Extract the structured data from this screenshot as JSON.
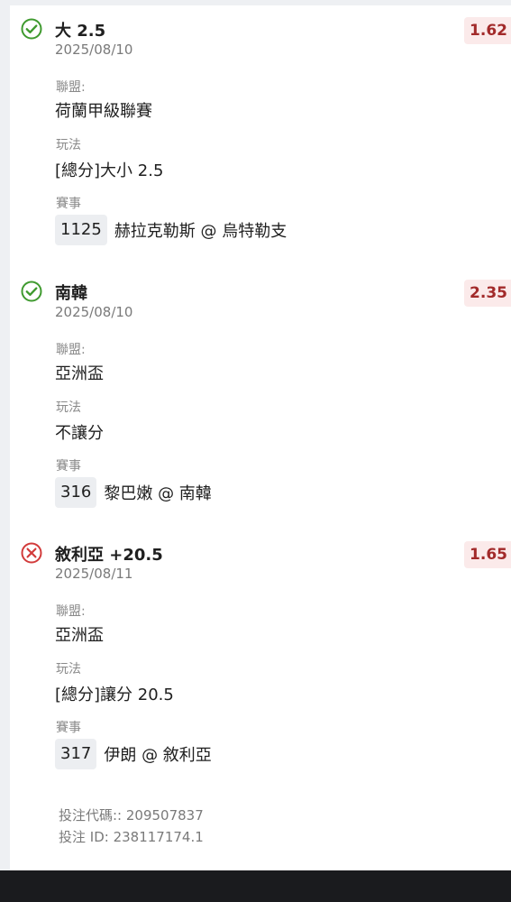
{
  "bets": [
    {
      "status": "win",
      "selection": "大 2.5",
      "odds": "1.62",
      "date": "2025/08/10",
      "league_label": "聯盟:",
      "league": "荷蘭甲級聯賽",
      "market_label": "玩法",
      "market": "[總分]大小 2.5",
      "event_label": "賽事",
      "event_code": "1125",
      "event_name": "赫拉克勒斯 @ 烏特勒支"
    },
    {
      "status": "win",
      "selection": "南韓",
      "odds": "2.35",
      "date": "2025/08/10",
      "league_label": "聯盟:",
      "league": "亞洲盃",
      "market_label": "玩法",
      "market": "不讓分",
      "event_label": "賽事",
      "event_code": "316",
      "event_name": "黎巴嫩 @ 南韓"
    },
    {
      "status": "lose",
      "selection": "敘利亞 +20.5",
      "odds": "1.65",
      "date": "2025/08/11",
      "league_label": "聯盟:",
      "league": "亞洲盃",
      "market_label": "玩法",
      "market": "[總分]讓分 20.5",
      "event_label": "賽事",
      "event_code": "317",
      "event_name": "伊朗 @ 敘利亞"
    }
  ],
  "footer": {
    "bet_code": "投注代碼:: 209507837",
    "bet_id": "投注 ID: 238117174.1"
  },
  "icons": {
    "win": "check-circle-icon",
    "lose": "x-circle-icon"
  },
  "colors": {
    "win": "#3f9a2f",
    "lose": "#d23b3b",
    "odds_text": "#a22a2a",
    "odds_bg": "#fbeaea"
  }
}
